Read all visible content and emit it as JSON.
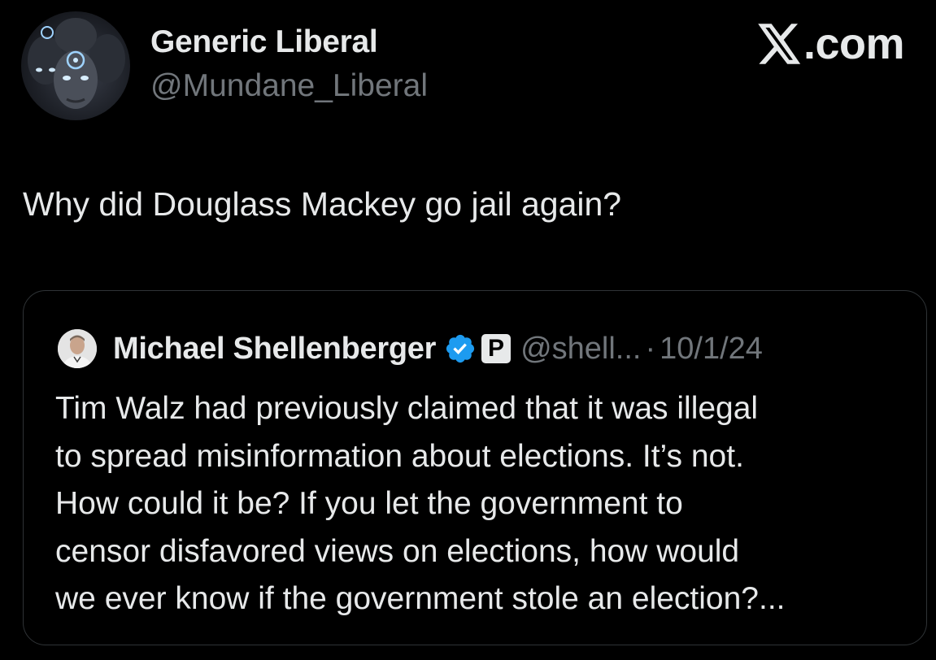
{
  "author": {
    "name": "Generic Liberal",
    "handle": "@Mundane_Liberal",
    "avatar_icon": "profile-avatar"
  },
  "brand": {
    "icon": "x-logo-icon",
    "text": ".com"
  },
  "tweet": {
    "text": "Why did Douglass Mackey go jail again?"
  },
  "quoted_tweet": {
    "author_name": "Michael Shellenberger",
    "verified_icon": "verified-badge-icon",
    "verified_color": "#1d9bf0",
    "affiliate_badge": "P",
    "handle": "@shell...",
    "separator": "·",
    "date": "10/1/24",
    "lines": [
      "Tim Walz had previously claimed that it was illegal",
      "to spread misinformation about elections. It’s not.",
      "How could it be? If you let the government to",
      "censor disfavored views on elections, how would",
      "we ever know if the government stole an election?..."
    ]
  },
  "colors": {
    "background": "#000000",
    "primary_text": "#e7e9ea",
    "secondary_text": "#71767b",
    "border": "#2f3336"
  }
}
